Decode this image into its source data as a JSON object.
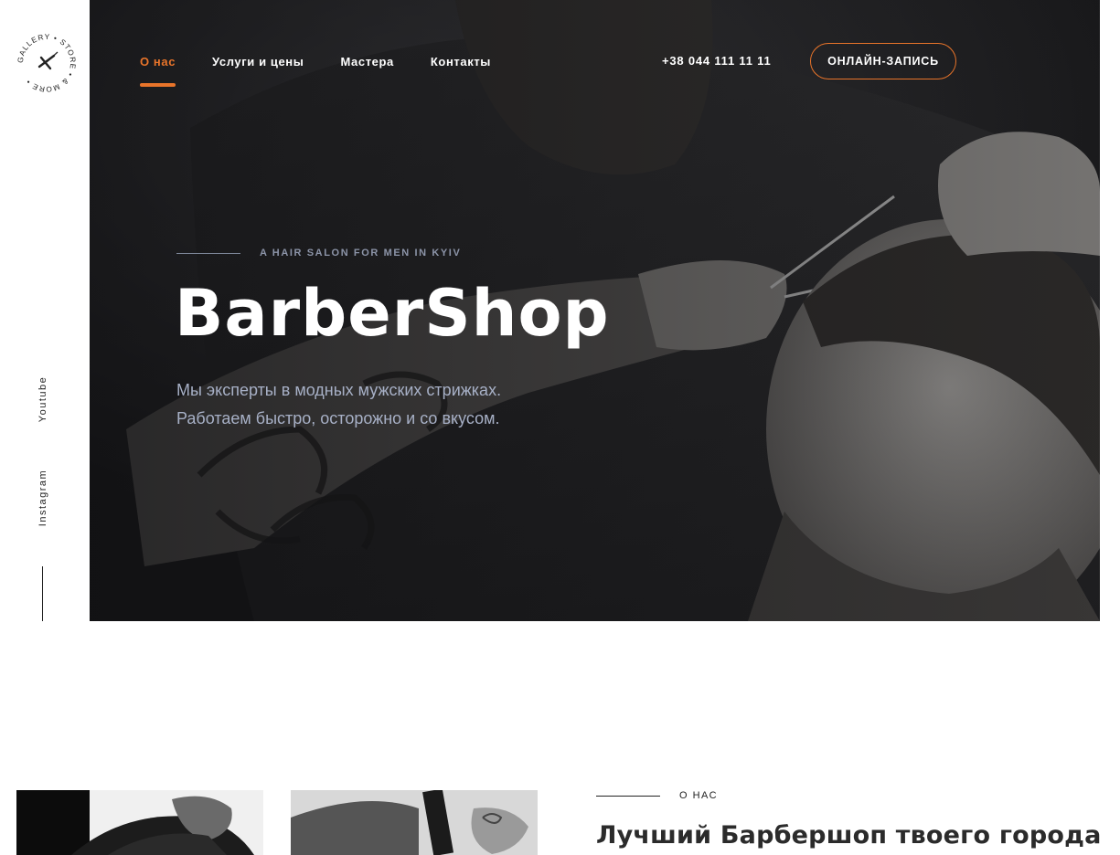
{
  "logo": {
    "text": "GALLERY • STORE • & MORE •",
    "icon": "razor-icon"
  },
  "social": {
    "youtube": "Youtube",
    "instagram": "Instagram"
  },
  "nav": {
    "items": [
      {
        "label": "О нас",
        "active": true
      },
      {
        "label": "Услуги и цены",
        "active": false
      },
      {
        "label": "Мастера",
        "active": false
      },
      {
        "label": "Контакты",
        "active": false
      }
    ]
  },
  "header": {
    "phone": "+38 044 111 11 11",
    "cta_label": "ОНЛАЙН-ЗАПИСЬ"
  },
  "hero": {
    "eyebrow": "A HAIR SALON FOR MEN IN KYIV",
    "title": "BarberShop",
    "subtitle_line1": "Мы эксперты в модных мужских стрижках.",
    "subtitle_line2": "Работаем быстро, осторожно и со вкусом."
  },
  "about": {
    "eyebrow": "О НАС",
    "title": "Лучший Барбершоп твоего города"
  },
  "colors": {
    "accent": "#e8742a",
    "hero_bg": "#1a1a1c",
    "subtitle": "#a7b0c6",
    "text_dark": "#2b2b2b"
  }
}
